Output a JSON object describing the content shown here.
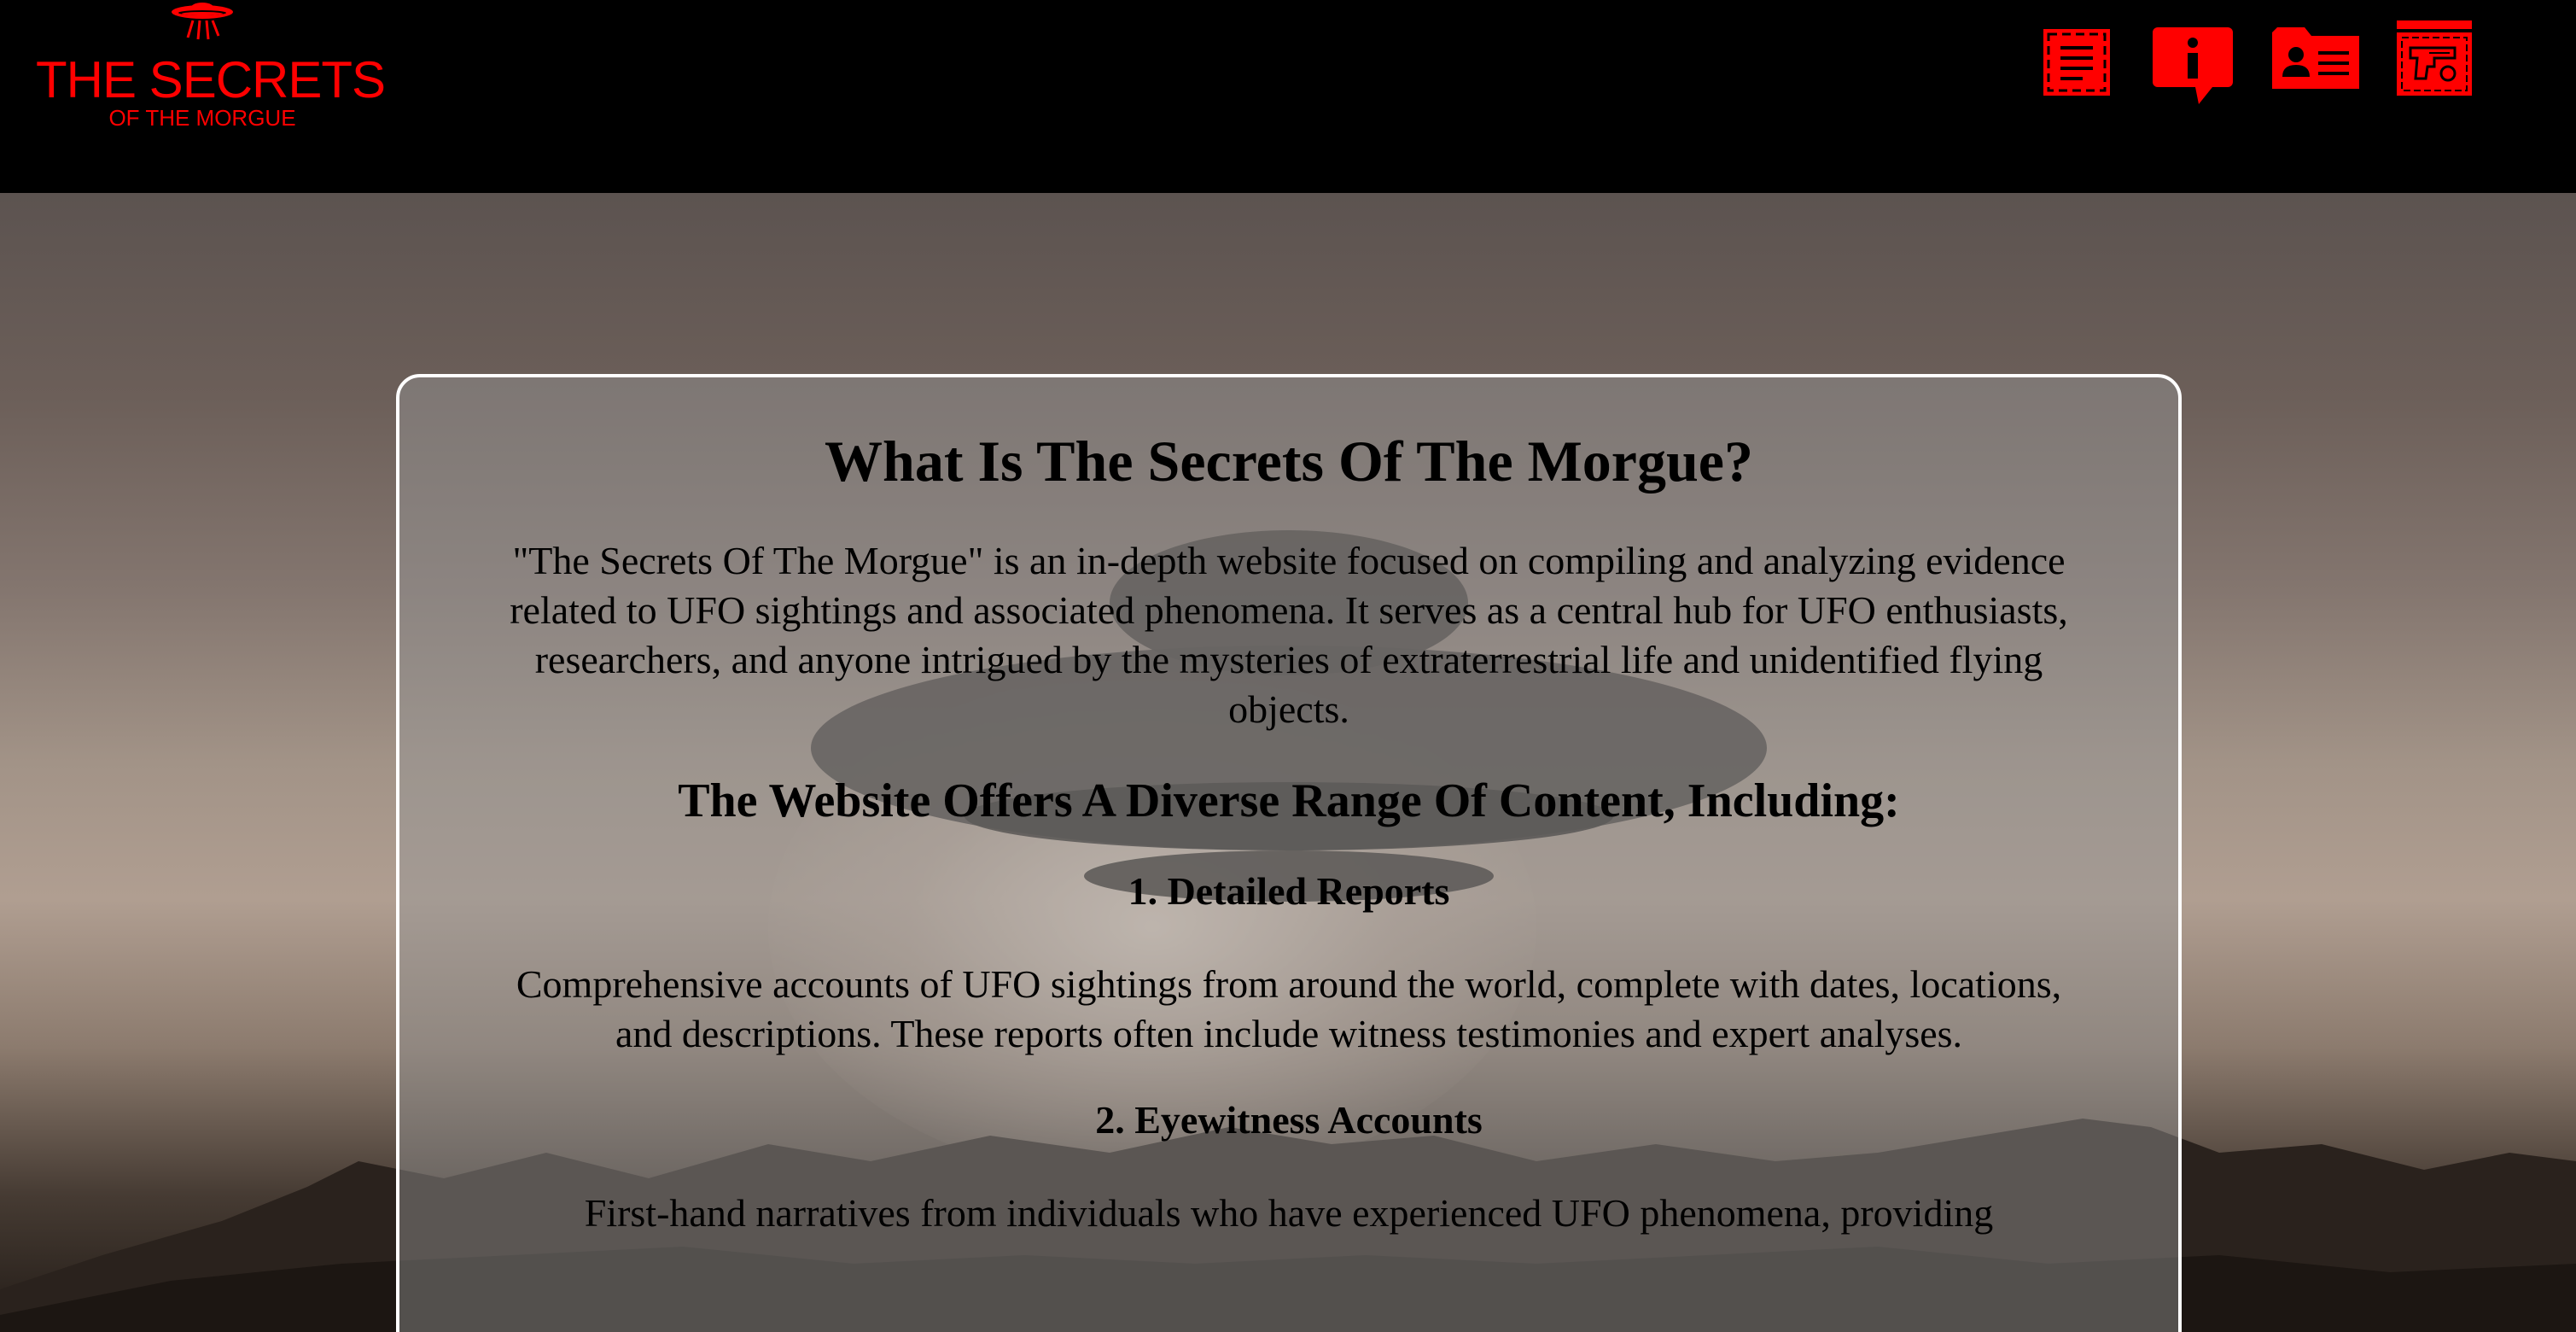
{
  "header": {
    "logo_title": "THE SECRETS",
    "logo_subtitle": "OF THE MORGUE",
    "nav": [
      {
        "name": "reports",
        "icon": "document-list-icon"
      },
      {
        "name": "about",
        "icon": "info-icon"
      },
      {
        "name": "contacts",
        "icon": "contact-card-icon"
      },
      {
        "name": "evidence",
        "icon": "evidence-gun-icon"
      }
    ],
    "accent_color": "#ff0000"
  },
  "main": {
    "title": "What Is The Secrets Of The Morgue?",
    "intro": "\"The Secrets Of The Morgue\" is an in-depth website focused on compiling and analyzing evidence related to UFO sightings and associated phenomena. It serves as a central hub for UFO enthusiasts, researchers, and anyone intrigued by the mysteries of extraterrestrial life and unidentified flying objects.",
    "subtitle": "The Website Offers A Diverse Range Of Content, Including:",
    "items": [
      {
        "heading": "1. Detailed Reports",
        "description": "Comprehensive accounts of UFO sightings from around the world, complete with dates, locations, and descriptions. These reports often include witness testimonies and expert analyses."
      },
      {
        "heading": "2. Eyewitness Accounts",
        "description": "First-hand narratives from individuals who have experienced UFO phenomena, providing"
      }
    ]
  }
}
